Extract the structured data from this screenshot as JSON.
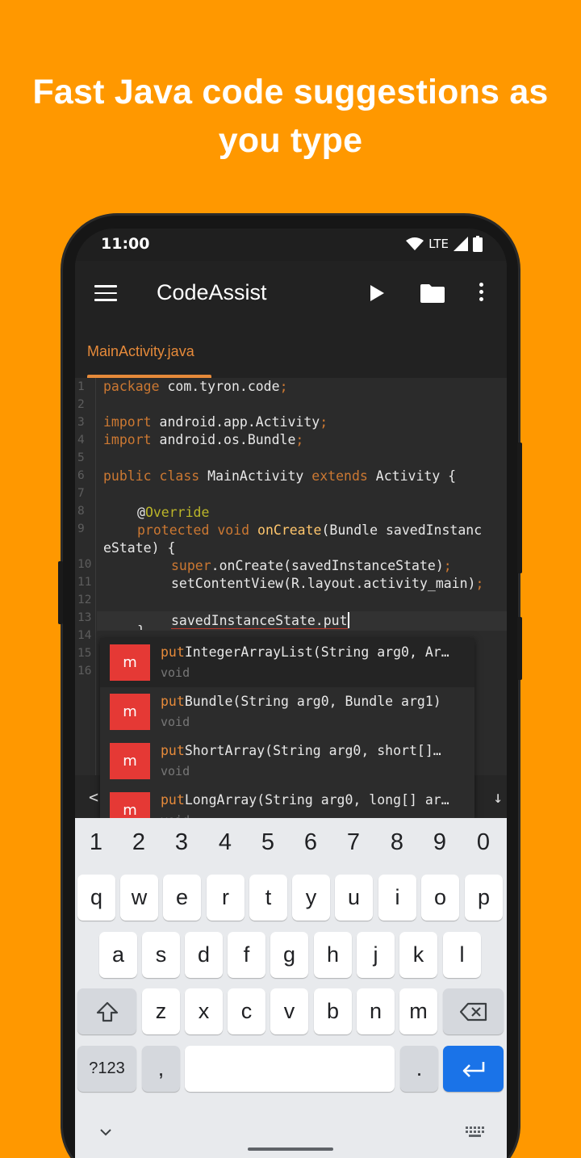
{
  "promo": {
    "headline_line1": "Fast Java code suggestions as",
    "headline_line2": "you type"
  },
  "statusbar": {
    "time": "11:00",
    "network": "LTE"
  },
  "appbar": {
    "title": "CodeAssist"
  },
  "tab": {
    "label": "MainActivity.java"
  },
  "editor": {
    "line_numbers": [
      "1",
      "2",
      "3",
      "4",
      "5",
      "6",
      "7",
      "8",
      "9",
      "10",
      "11",
      "12",
      "13",
      "14",
      "15",
      "16"
    ],
    "lines": {
      "l1_kw": "package",
      "l1_rest": " com.tyron.code",
      "semi": ";",
      "l3_kw": "import",
      "l3_rest": " android.app.Activity",
      "l4_kw": "import",
      "l4_rest": " android.os.Bundle",
      "l6_kw1": "public class",
      "l6_mid": " MainActivity ",
      "l6_kw2": "extends",
      "l6_rest": " Activity {",
      "l8_at": "@",
      "l8_ann": "Override",
      "l9_kw": "protected void",
      "l9_fn": " onCreate",
      "l9_rest": "(Bundle savedInstanc",
      "l9_wrap": "eState) {",
      "l10_kw": "super",
      "l10_rest": ".onCreate(savedInstanceState)",
      "l11_rest": "setContentView(R.layout.activity_main)",
      "l13_pre": "savedInstanceState.",
      "l13_typed": "put",
      "l14": "}"
    }
  },
  "completion": {
    "items": [
      {
        "badge": "m",
        "prefix": "put",
        "rest": "IntegerArrayList(String arg0, Ar…",
        "type": "void"
      },
      {
        "badge": "m",
        "prefix": "put",
        "rest": "Bundle(String arg0, Bundle arg1)",
        "type": "void"
      },
      {
        "badge": "m",
        "prefix": "put",
        "rest": "ShortArray(String arg0, short[]…",
        "type": "void"
      },
      {
        "badge": "m",
        "prefix": "put",
        "rest": "LongArray(String arg0, long[] ar…",
        "type": "void"
      }
    ]
  },
  "symbols": {
    "left": "<",
    "right": "↓"
  },
  "keyboard": {
    "numbers": [
      "1",
      "2",
      "3",
      "4",
      "5",
      "6",
      "7",
      "8",
      "9",
      "0"
    ],
    "row1": [
      "q",
      "w",
      "e",
      "r",
      "t",
      "y",
      "u",
      "i",
      "o",
      "p"
    ],
    "row2": [
      "a",
      "s",
      "d",
      "f",
      "g",
      "h",
      "j",
      "k",
      "l"
    ],
    "row3": [
      "z",
      "x",
      "c",
      "v",
      "b",
      "n",
      "m"
    ],
    "sym_label": "?123",
    "comma": ",",
    "period": "."
  },
  "colors": {
    "background": "#FF9800",
    "accent": "#e68a3a",
    "badge": "#e53935",
    "enter": "#1a73e8"
  }
}
